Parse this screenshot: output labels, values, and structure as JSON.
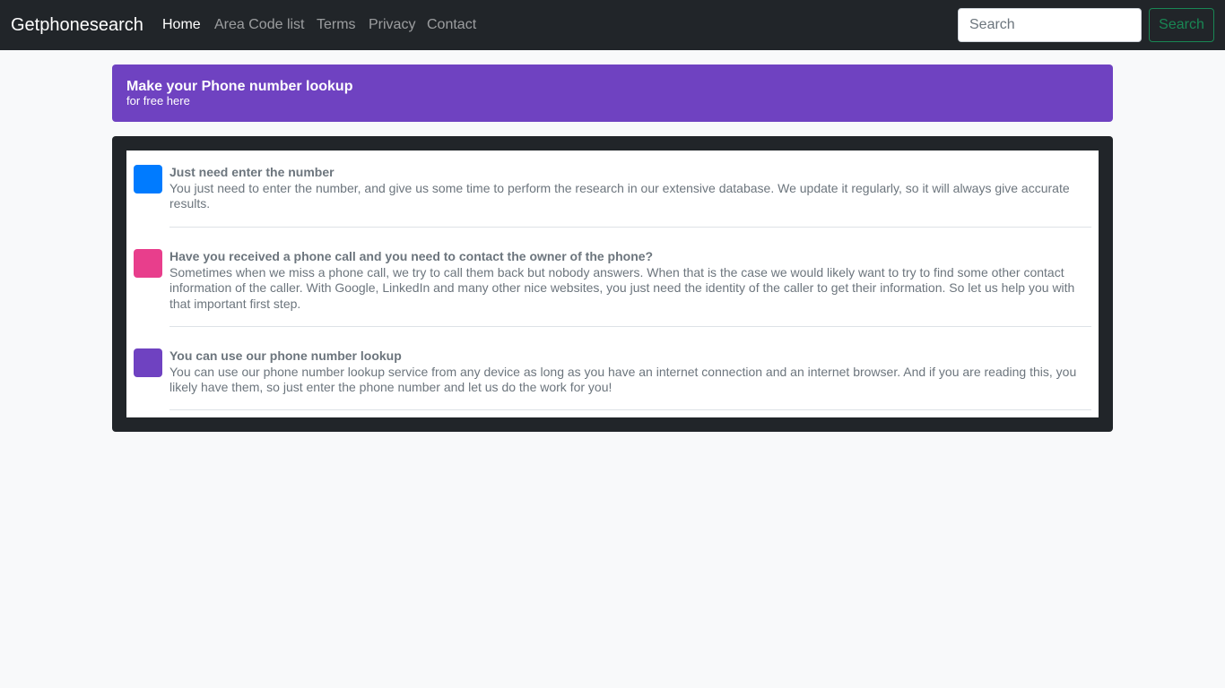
{
  "navbar": {
    "brand": "Getphonesearch",
    "links": [
      {
        "label": "Home",
        "active": true
      },
      {
        "label": "Area Code list",
        "active": false
      },
      {
        "label": "Terms",
        "active": false
      },
      {
        "label": "Privacy",
        "active": false
      },
      {
        "label": "Contact",
        "active": false
      }
    ],
    "search": {
      "placeholder": "Search",
      "value": "",
      "button_label": "Search"
    }
  },
  "banner": {
    "title": "Make your Phone number lookup",
    "subtitle": "for free here"
  },
  "features": [
    {
      "title": "Just need enter the number",
      "body": "You just need to enter the number, and give us some time to perform the research in our extensive database. We update it regularly, so it will always give accurate results.",
      "color": "#007bff"
    },
    {
      "title": "Have you received a phone call and you need to contact the owner of the phone?",
      "body": "Sometimes when we miss a phone call, we try to call them back but nobody answers. When that is the case we would likely want to try to find some other contact information of the caller. With Google, LinkedIn and many other nice websites, you just need the identity of the caller to get their information. So let us help you with that important first step.",
      "color": "#e83e8c"
    },
    {
      "title": "You can use our phone number lookup",
      "body": "You can use our phone number lookup service from any device as long as you have an internet connection and an internet browser. And if you are reading this, you likely have them, so just enter the phone number and let us do the work for you!",
      "color": "#6f42c1"
    }
  ],
  "colors": {
    "navbar": "#212529",
    "banner": "#6f42c1",
    "search_button": "#198754",
    "page_background": "#f8f9fa"
  }
}
